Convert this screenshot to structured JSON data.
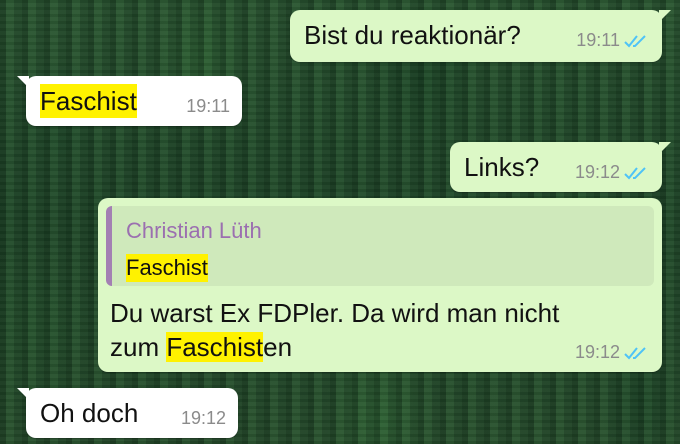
{
  "colors": {
    "outgoing": "#dcf8c6",
    "incoming": "#ffffff",
    "highlight": "#fff200",
    "read_ticks": "#4fc3f7",
    "quote_name": "#9b6fb0"
  },
  "messages": [
    {
      "direction": "outgoing",
      "text": "Bist du reaktionär?",
      "time": "19:11",
      "status": "read"
    },
    {
      "direction": "incoming",
      "text": "Faschist",
      "highlighted": "Faschist",
      "time": "19:11"
    },
    {
      "direction": "outgoing",
      "text": "Links?",
      "time": "19:12",
      "status": "read"
    },
    {
      "direction": "outgoing",
      "quote": {
        "author": "Christian Lüth",
        "text": "Faschist"
      },
      "text_line1": "Du warst Ex FDPler. Da wird man nicht",
      "text_line2_pre": "zum ",
      "text_line2_hl": "Faschist",
      "text_line2_post": "en",
      "time": "19:12",
      "status": "read"
    },
    {
      "direction": "incoming",
      "text": "Oh doch",
      "time": "19:12"
    }
  ]
}
